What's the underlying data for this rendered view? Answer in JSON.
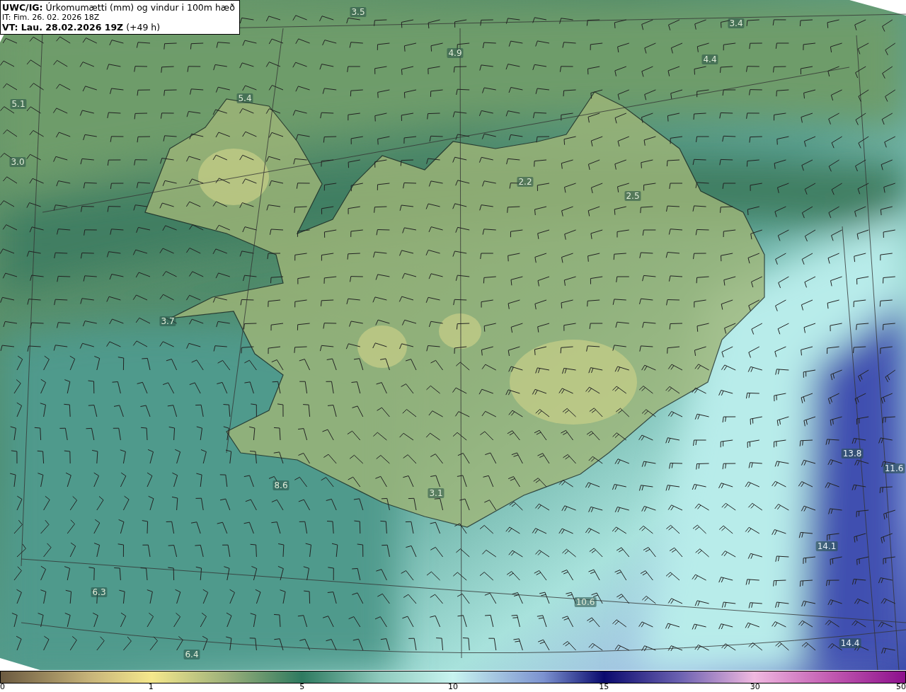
{
  "header": {
    "title": "**UWC/IG:** Úrkomumætti (mm) og vindur i 100m hæð",
    "issued": "IT: Fim. 26. 02. 2026 18Z",
    "valid": "**VT: Lau. 28.02.2026 19Z** (+49 h)"
  },
  "map": {
    "values": [
      "3.5",
      "3.4",
      "4.9",
      "4.4",
      "5.4",
      "5.1",
      "3.0",
      "3.7",
      "2.2",
      "2.5",
      "3.1",
      "8.6",
      "6.3",
      "6.4",
      "10.6",
      "13.8",
      "11.6",
      "14.1",
      "14.4"
    ]
  },
  "colorbar": {
    "ticks": [
      "0",
      "1",
      "5",
      "10",
      "15",
      "30",
      "50"
    ]
  }
}
